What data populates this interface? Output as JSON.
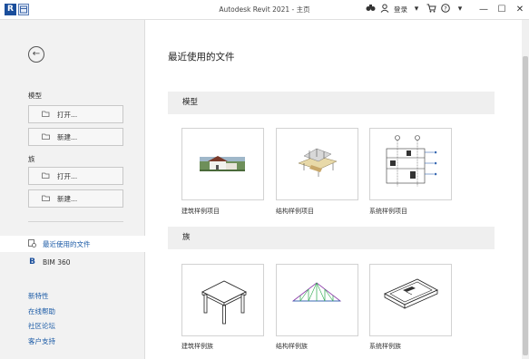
{
  "titlebar": {
    "title": "Autodesk Revit 2021 - 主页",
    "logo_letter": "R",
    "login_label": "登录",
    "search_icon": "binoculars-icon",
    "cart_icon": "cart-icon",
    "help_icon": "help-icon",
    "minimize": "—",
    "maximize": "☐",
    "close": "✕"
  },
  "sidebar": {
    "back_icon": "←",
    "model_label": "模型",
    "model_open": "打开...",
    "model_new": "新建...",
    "family_label": "族",
    "family_open": "打开...",
    "family_new": "新建...",
    "recent_files": "最近使用的文件",
    "bim360_icon": "B",
    "bim360": "BIM 360",
    "links": [
      "新特性",
      "在线帮助",
      "社区论坛",
      "客户支持"
    ]
  },
  "main": {
    "title": "最近使用的文件",
    "models_header": "模型",
    "families_header": "族",
    "models": [
      {
        "label": "建筑样例项目",
        "thumb": "house-render"
      },
      {
        "label": "结构样例项目",
        "thumb": "structure-render"
      },
      {
        "label": "系统样例项目",
        "thumb": "systems-drawing"
      }
    ],
    "families": [
      {
        "label": "建筑样例族",
        "thumb": "table"
      },
      {
        "label": "结构样例族",
        "thumb": "truss"
      },
      {
        "label": "系统样例族",
        "thumb": "box-fixture"
      }
    ]
  },
  "colors": {
    "accent": "#1a5aa6",
    "sidebar_bg": "#f2f2f2",
    "section_bg": "#efefef"
  }
}
